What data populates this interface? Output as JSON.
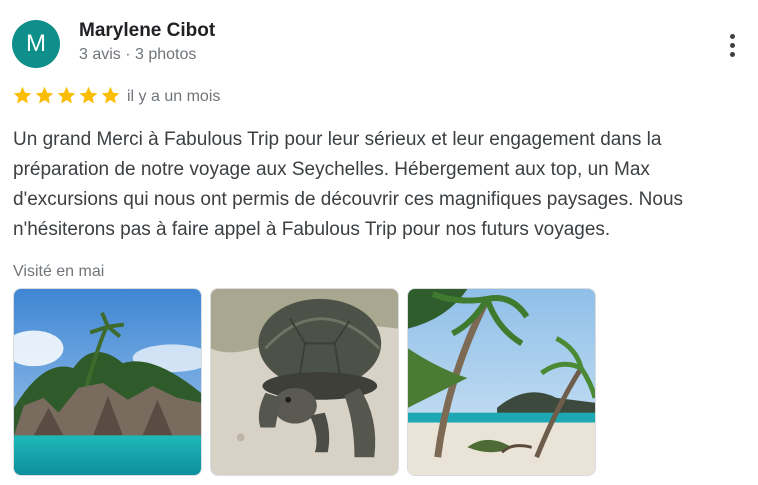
{
  "reviewer": {
    "avatar_letter": "M",
    "name": "Marylene Cibot",
    "meta": "3 avis · 3 photos"
  },
  "rating": {
    "value": 5,
    "max": 5,
    "date": "il y a un mois"
  },
  "review_text": "Un grand Merci à Fabulous Trip pour leur sérieux et leur engagement dans la préparation de notre voyage aux Seychelles. Hébergement aux top, un Max d'excursions qui nous ont permis de découvrir ces magnifiques paysages. Nous n'hésiterons pas à faire appel à Fabulous Trip pour nos futurs voyages.",
  "visited": "Visité en mai",
  "photos": [
    "island-rocks-photo",
    "giant-tortoise-photo",
    "palm-beach-photo"
  ],
  "colors": {
    "avatar": "#0e8f8a",
    "star": "#fbbc04",
    "muted": "#70757a",
    "text": "#3c4043"
  },
  "icons": {
    "menu": "more-vert-icon",
    "star": "star-icon"
  }
}
